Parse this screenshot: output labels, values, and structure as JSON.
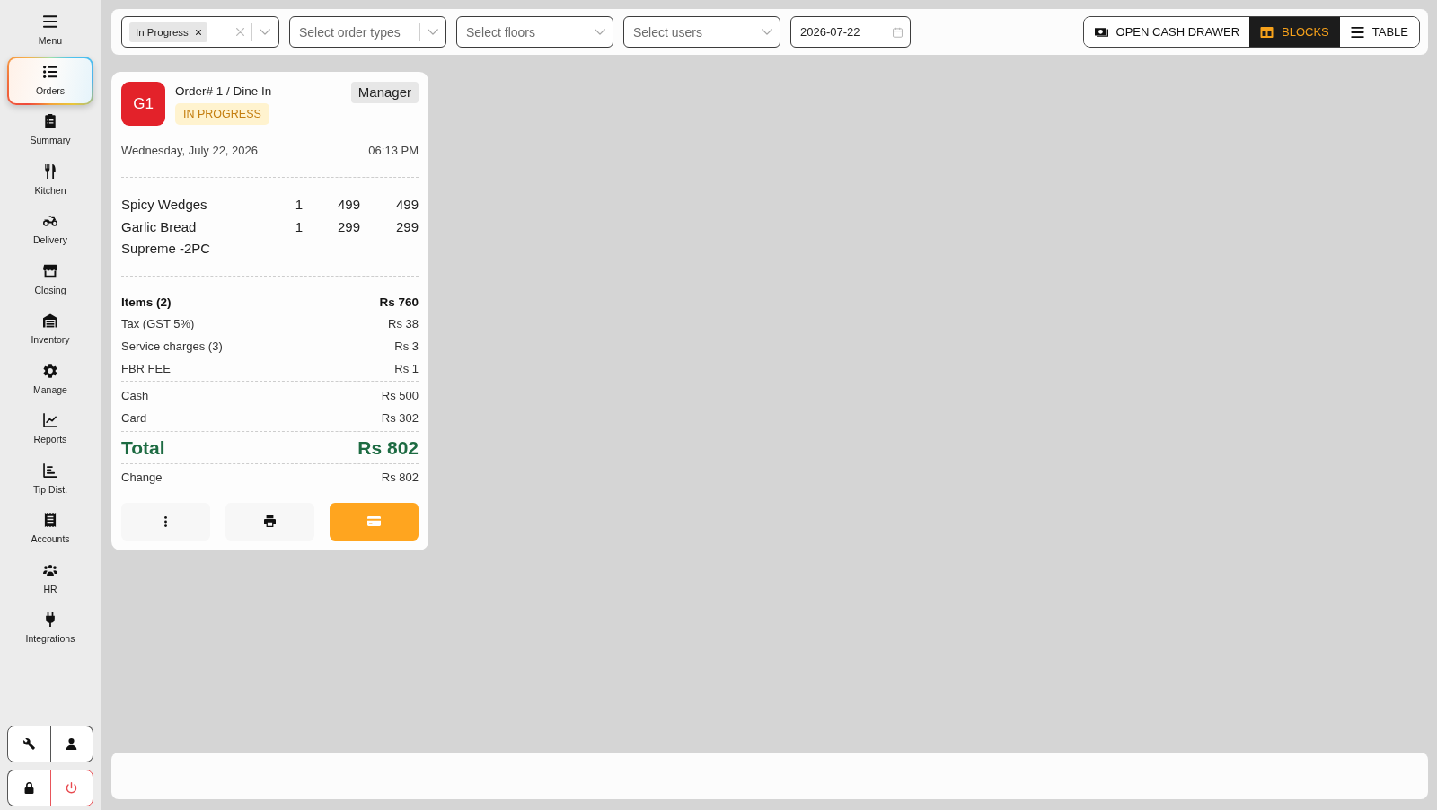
{
  "sidebar": {
    "items": [
      {
        "label": "Menu",
        "selected": false
      },
      {
        "label": "Orders",
        "selected": true
      },
      {
        "label": "Summary",
        "selected": false
      },
      {
        "label": "Kitchen",
        "selected": false
      },
      {
        "label": "Delivery",
        "selected": false
      },
      {
        "label": "Closing",
        "selected": false
      },
      {
        "label": "Inventory",
        "selected": false
      },
      {
        "label": "Manage",
        "selected": false
      },
      {
        "label": "Reports",
        "selected": false
      },
      {
        "label": "Tip Dist.",
        "selected": false
      },
      {
        "label": "Accounts",
        "selected": false
      },
      {
        "label": "HR",
        "selected": false
      },
      {
        "label": "Integrations",
        "selected": false
      }
    ]
  },
  "top_bar": {
    "filters": [
      {
        "kind": "multiselect",
        "chips": [
          "In Progress"
        ],
        "clearable": true,
        "divider": true
      },
      {
        "kind": "select",
        "placeholder": "Select order types",
        "divider": true
      },
      {
        "kind": "select",
        "placeholder": "Select floors",
        "divider": false
      },
      {
        "kind": "select",
        "placeholder": "Select users",
        "divider": true
      },
      {
        "kind": "date",
        "value": "2026-07-22"
      }
    ],
    "actions": [
      {
        "label": "OPEN CASH DRAWER"
      }
    ],
    "views": [
      {
        "label": "BLOCKS",
        "selected": true
      },
      {
        "label": "TABLE",
        "selected": false
      }
    ]
  },
  "orders": [
    {
      "table": "G1",
      "title": "Order# 1 / Dine In",
      "status": "IN PROGRESS",
      "user": "Manager",
      "date": "Wednesday, July 22, 2026",
      "time": "06:13 PM",
      "items": [
        {
          "name": "Spicy Wedges",
          "qty": "1",
          "price": "499",
          "total": "499"
        },
        {
          "name": "Garlic Bread",
          "qty": "1",
          "price": "299",
          "total": "299"
        },
        {
          "name": "Supreme -2PC"
        }
      ],
      "summary_sections": [
        {
          "rows": [
            {
              "kind": "subtotal",
              "label": "Items (2)",
              "value": "Rs 760"
            },
            {
              "kind": "line",
              "label": "Tax (GST 5%)",
              "value": "Rs 38"
            },
            {
              "kind": "line",
              "label": "Service charges (3)",
              "value": "Rs 3"
            },
            {
              "kind": "line",
              "label": "FBR FEE",
              "value": "Rs 1"
            }
          ]
        },
        {
          "rows": [
            {
              "kind": "line",
              "label": "Cash",
              "value": "Rs 500"
            },
            {
              "kind": "line",
              "label": "Card",
              "value": "Rs 302"
            }
          ]
        },
        {
          "rows": [
            {
              "kind": "grand",
              "label": "Total",
              "value": "Rs 802"
            }
          ]
        },
        {
          "rows": [
            {
              "kind": "line",
              "label": "Change",
              "value": "Rs 802"
            }
          ]
        }
      ]
    }
  ]
}
